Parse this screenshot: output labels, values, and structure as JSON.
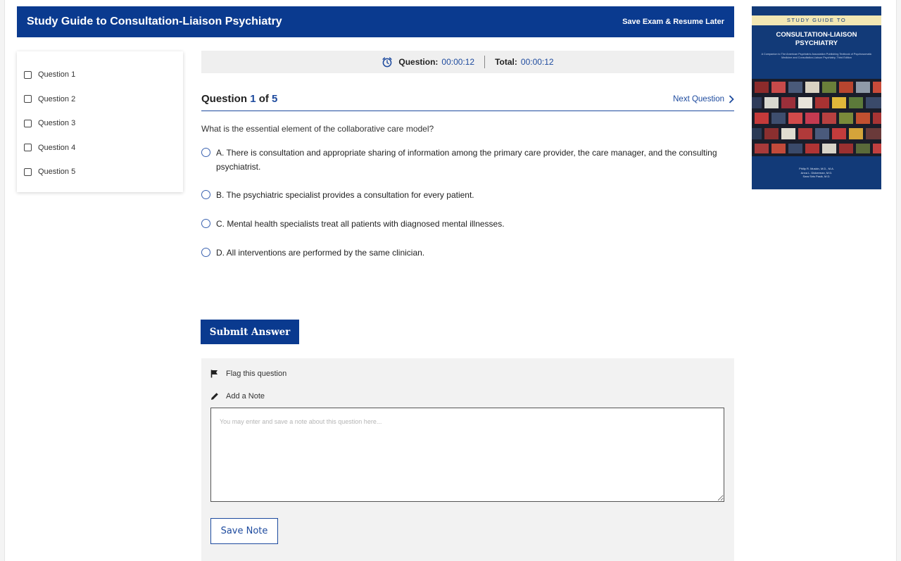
{
  "header": {
    "title": "Study Guide to Consultation-Liaison Psychiatry",
    "save_resume": "Save Exam & Resume Later"
  },
  "sidebar": {
    "items": [
      {
        "label": "Question 1"
      },
      {
        "label": "Question 2"
      },
      {
        "label": "Question 3"
      },
      {
        "label": "Question 4"
      },
      {
        "label": "Question 5"
      }
    ]
  },
  "timer": {
    "question_label": "Question:",
    "question_value": "00:00:12",
    "total_label": "Total:",
    "total_value": "00:00:12",
    "icon": "alarm-clock-icon"
  },
  "question": {
    "prefix": "Question",
    "current": "1",
    "of": "of",
    "total": "5",
    "next_label": "Next Question",
    "stem": "What is the essential element of the collaborative care model?",
    "options": [
      {
        "text": "A. There is consultation and appropriate sharing of information among the primary care provider, the care manager, and the consulting psychiatrist."
      },
      {
        "text": "B. The psychiatric specialist provides a consultation for every patient."
      },
      {
        "text": "C. Mental health specialists treat all patients with diagnosed mental illnesses."
      },
      {
        "text": "D. All interventions are performed by the same clinician."
      }
    ]
  },
  "actions": {
    "submit_label": "Submit Answer"
  },
  "notes": {
    "flag_label": "Flag this question",
    "add_note_label": "Add a Note",
    "placeholder": "You may enter and save a note about this question here...",
    "save_label": "Save Note"
  },
  "cover": {
    "top_label": "STUDY GUIDE TO",
    "title_line1": "CONSULTATION-LIAISON",
    "title_line2": "PSYCHIATRY",
    "subtitle": "A Companion to The American Psychiatric Association Publishing Textbook of Psychosomatic Medicine and Consultation-Liaison Psychiatry, Third Edition",
    "authors": [
      "Philip R. Muskin, M.D., M.A.",
      "Anna L. Dickerman, M.D.",
      "Sara Siris Pasik, M.D."
    ]
  },
  "colors": {
    "brand_blue": "#0a3a8f",
    "link_blue": "#1d4a9e",
    "panel_gray": "#f2f2f2"
  }
}
